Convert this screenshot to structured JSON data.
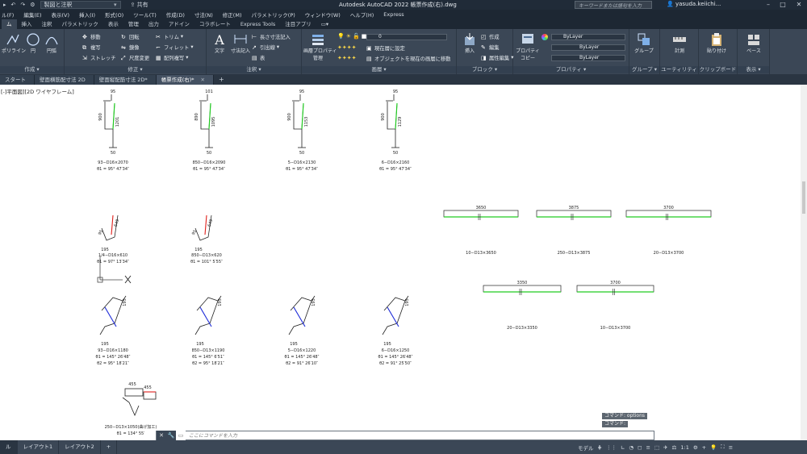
{
  "titlebar": {
    "workspace": "製図と注釈",
    "share": "共有",
    "title": "Autodesk AutoCAD 2022   帳票作成(右).dwg",
    "search_placeholder": "キーワードまたは語句を入力",
    "user": "yasuda.keiichi..."
  },
  "menu": [
    "ル(F)",
    "編集(E)",
    "表示(V)",
    "挿入(I)",
    "形式(O)",
    "ツール(T)",
    "作成(D)",
    "寸法(N)",
    "修正(M)",
    "パラメトリック(P)",
    "ウィンドウ(W)",
    "ヘルプ(H)",
    "Express"
  ],
  "ribbon_tabs": [
    "ム",
    "挿入",
    "注釈",
    "パラメトリック",
    "表示",
    "管理",
    "出力",
    "アドイン",
    "コラボレート",
    "Express Tools",
    "注目アプリ"
  ],
  "ribbon": {
    "draw": {
      "polyline": "ポリライン",
      "circle": "円",
      "arc": "円弧",
      "title": "作成 ▾"
    },
    "modify": {
      "move": "移動",
      "rotate": "回転",
      "trim": "トリム",
      "copy": "複写",
      "mirror": "鏡像",
      "fillet": "フィレット",
      "stretch": "ストレッチ",
      "scale": "尺度変更",
      "array": "配列複写",
      "title": "修正 ▾"
    },
    "annotation": {
      "text": "文字",
      "dimension": "寸法記入",
      "linear": "長さ寸法記入",
      "leader": "引出線",
      "table": "表",
      "title": "注釈 ▾"
    },
    "layers": {
      "props": "画層プロパティ",
      "manage": "管理",
      "layer_value": "0",
      "set_current": "現在層に設定",
      "match": "オブジェクトを現在の画層に移動",
      "title": "画層 ▾"
    },
    "block": {
      "insert": "挿入",
      "create": "作成",
      "edit": "編集",
      "attr": "属性編集",
      "title": "ブロック ▾"
    },
    "properties": {
      "match": "プロパティ",
      "copy": "コピー",
      "bylayer1": "ByLayer",
      "bylayer2": "ByLayer",
      "bylayer3": "ByLayer",
      "title": "プロパティ ▾"
    },
    "groups": {
      "group": "グループ",
      "title": "グループ ▾"
    },
    "utilities": {
      "measure": "計測",
      "title": "ユーティリティ ▾"
    },
    "clipboard": {
      "paste": "貼り付け",
      "title": "クリップボード"
    },
    "view": {
      "base": "ベース",
      "title": "表示 ▾"
    }
  },
  "file_tabs": [
    "スタート",
    "壁面横筋配寸法 2D",
    "壁面縦配筋寸法 2D*",
    "帳票作成(右)*"
  ],
  "view_label": "[-]平面図][2D ワイヤフレーム]",
  "drawing": {
    "row1": [
      {
        "top": "95",
        "mid": "1201",
        "left": "900",
        "bot": "50",
        "label": "93−D16×2070",
        "angle": "θ1 = 95° 47′34″"
      },
      {
        "top": "101",
        "mid": "1095",
        "left": "890",
        "bot": "50",
        "label": "850−D16×2090",
        "angle": "θ1 = 95° 47′34″"
      },
      {
        "top": "95",
        "mid": "1153",
        "left": "900",
        "bot": "50",
        "label": "5−D16×2130",
        "angle": "θ1 = 95° 47′34″"
      },
      {
        "top": "95",
        "mid": "1129",
        "left": "900",
        "bot": "50",
        "label": "6−D16×2160",
        "angle": "θ1 = 95° 47′34″"
      }
    ],
    "row2": [
      {
        "dim": "649",
        "small": "95",
        "bot": "195",
        "label": "1/4−D16×610",
        "angle": "θ1 = 97° 13′34″"
      },
      {
        "dim": "649",
        "small": "95",
        "bot": "195",
        "label": "850−D13×620",
        "angle": "θ1 = 101° 5′55″"
      }
    ],
    "row3": [
      {
        "label": "93−D16×1180",
        "a1": "θ1 = 145° 26′48″",
        "a2": "θ2 = 95° 18′21″",
        "side": "195",
        "bot": "195"
      },
      {
        "label": "850−D13×1190",
        "a1": "θ1 = 145° 6′51″",
        "a2": "θ2 = 95° 18′21″",
        "side": "195",
        "bot": "195"
      },
      {
        "label": "5−D16×1220",
        "a1": "θ1 = 145° 26′48″",
        "a2": "θ2 = 91° 26′10″",
        "side": "195",
        "bot": "195"
      },
      {
        "label": "6−D16×1250",
        "a1": "θ1 = 145° 26′48″",
        "a2": "θ2 = 91° 25′50″",
        "side": "195",
        "bot": "195"
      }
    ],
    "row4": {
      "d1": "455",
      "d2": "455",
      "label": "250−D13×1050(曲げ加工)",
      "angle": "θ1 = 134° 55′"
    },
    "straight_bars_1": [
      {
        "dim": "3650",
        "label": "10−D13×3650"
      },
      {
        "dim": "3875",
        "label": "250−D13×3875"
      },
      {
        "dim": "3700",
        "label": "20−D13×3700"
      }
    ],
    "straight_bars_2": [
      {
        "dim": "3350",
        "label": "20−D13×3350"
      },
      {
        "dim": "3700",
        "label": "10−D13×3700"
      }
    ]
  },
  "command": {
    "history1": "コマンド:  options",
    "history2": "コマンド:",
    "placeholder": "ここにコマンドを入力"
  },
  "status": {
    "layouts": [
      "ル",
      "レイアウト1",
      "レイアウト2"
    ],
    "model": "モデル",
    "scale": "1:1"
  }
}
